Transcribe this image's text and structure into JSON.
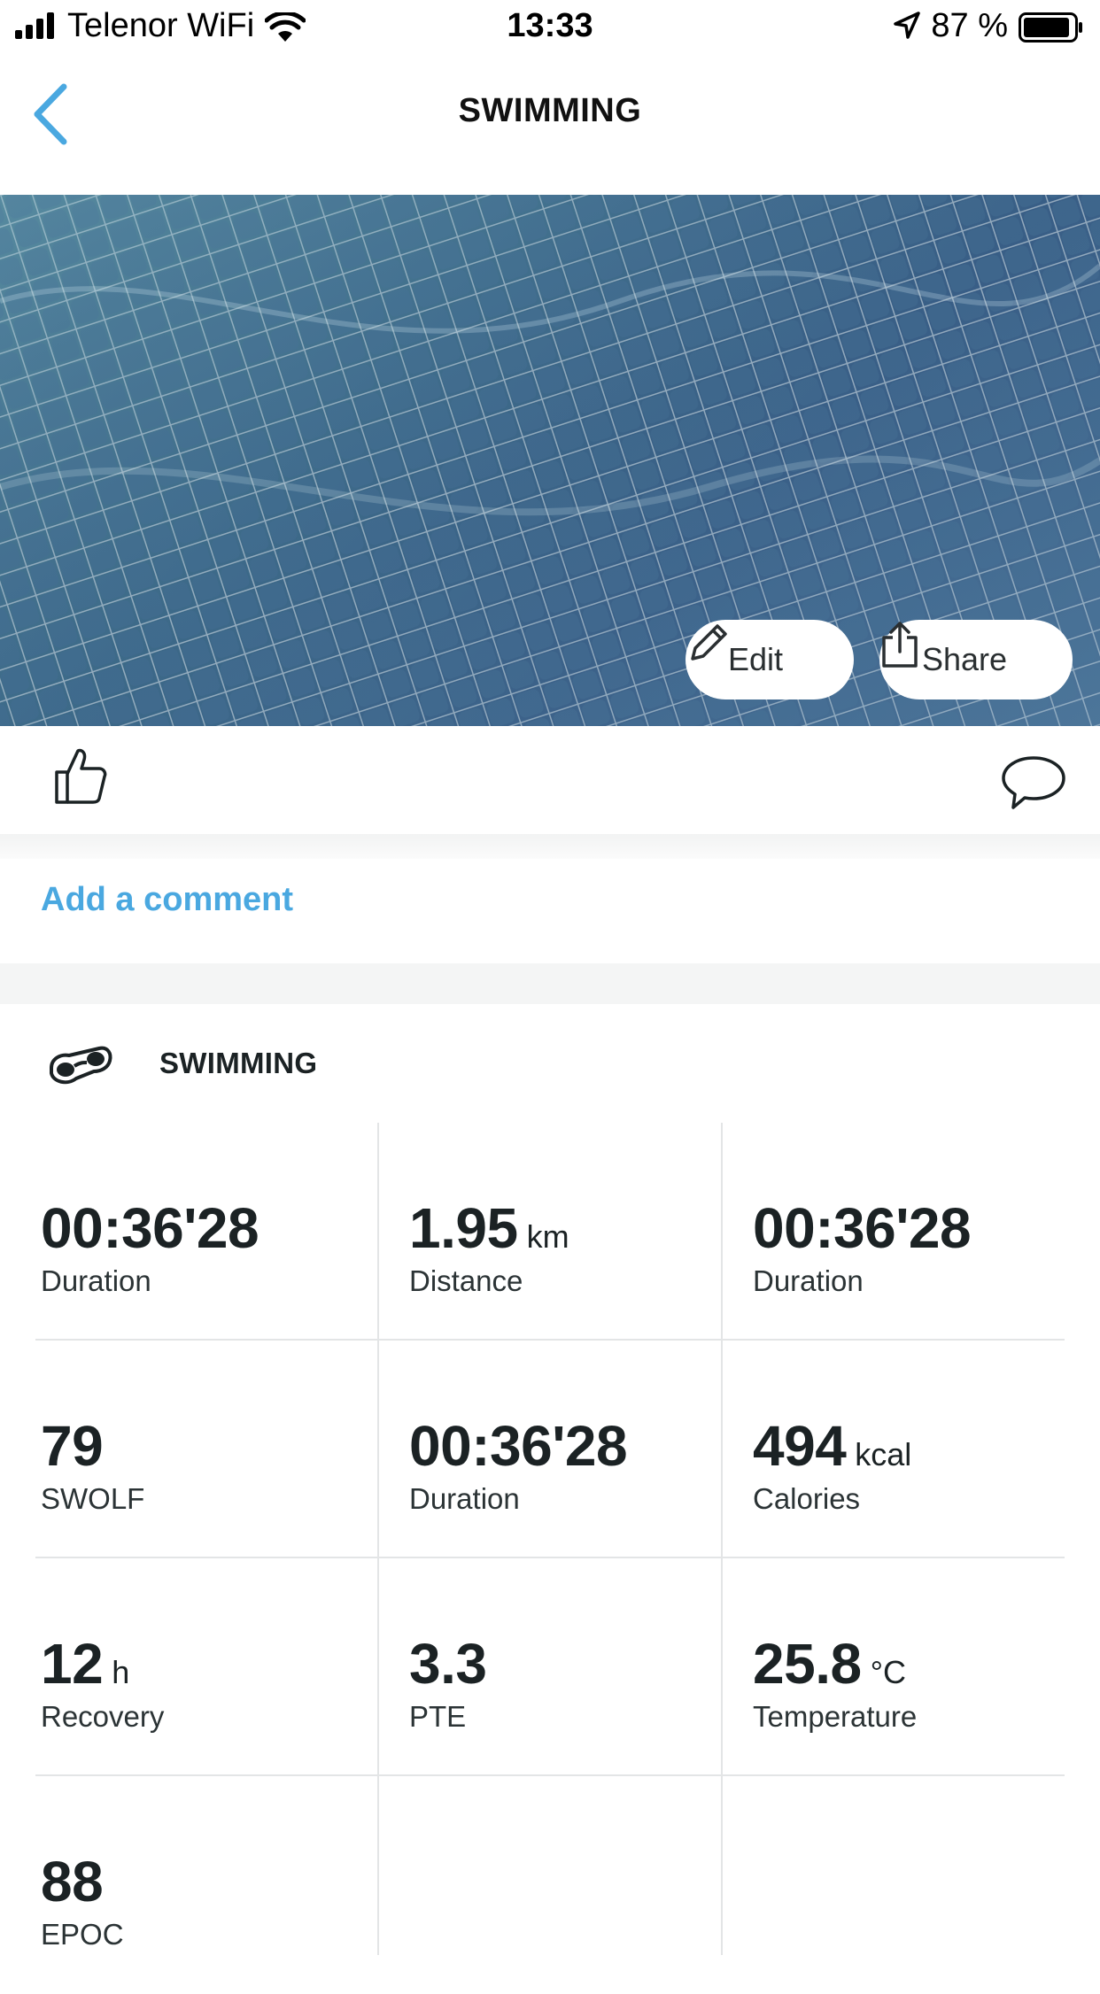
{
  "status_bar": {
    "carrier": "Telenor WiFi",
    "time": "13:33",
    "battery_percent": "87 %",
    "icons": [
      "signal-bars-icon",
      "wifi-icon",
      "location-arrow-icon",
      "battery-icon"
    ]
  },
  "nav": {
    "title": "SWIMMING",
    "back_icon": "chevron-left-icon"
  },
  "hero": {
    "edit_label": "Edit",
    "share_label": "Share",
    "edit_icon": "pencil-icon",
    "share_icon": "share-icon"
  },
  "reactions": {
    "like_icon": "thumbs-up-icon",
    "comment_icon": "speech-bubble-icon"
  },
  "comment": {
    "add_label": "Add a comment"
  },
  "activity": {
    "name": "SWIMMING",
    "icon": "swimming-goggles-icon"
  },
  "stats": [
    {
      "value": "00:36'28",
      "unit": "",
      "label": "Duration"
    },
    {
      "value": "1.95",
      "unit": "km",
      "label": "Distance"
    },
    {
      "value": "00:36'28",
      "unit": "",
      "label": "Duration"
    },
    {
      "value": "79",
      "unit": "",
      "label": "SWOLF"
    },
    {
      "value": "00:36'28",
      "unit": "",
      "label": "Duration"
    },
    {
      "value": "494",
      "unit": "kcal",
      "label": "Calories"
    },
    {
      "value": "12",
      "unit": "h",
      "label": "Recovery"
    },
    {
      "value": "3.3",
      "unit": "",
      "label": "PTE"
    },
    {
      "value": "25.8",
      "unit": "°C",
      "label": "Temperature"
    },
    {
      "value": "88",
      "unit": "",
      "label": "EPOC"
    }
  ],
  "colors": {
    "accent": "#4aa8e0",
    "text": "#1b2224",
    "divider": "#e3e5e6",
    "pool": "#3f6d8a"
  }
}
